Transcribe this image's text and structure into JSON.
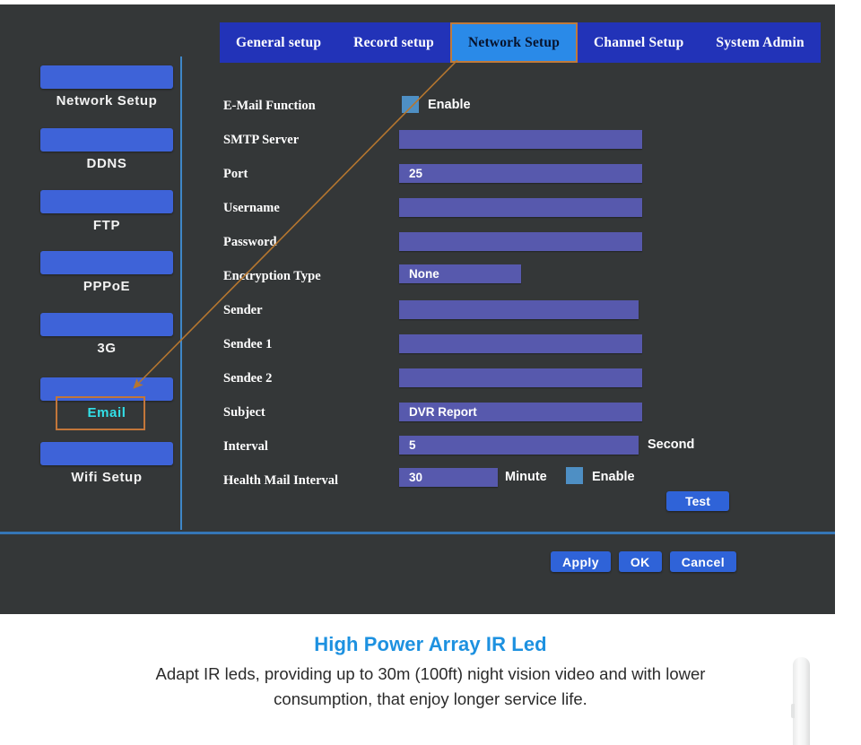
{
  "panel": {
    "tabs": [
      {
        "label": "General setup",
        "active": false
      },
      {
        "label": "Record setup",
        "active": false
      },
      {
        "label": "Network Setup",
        "active": true
      },
      {
        "label": "Channel Setup",
        "active": false
      },
      {
        "label": "System Admin",
        "active": false
      }
    ],
    "sidebar": {
      "items": [
        {
          "label": "Network  Setup",
          "highlight": false
        },
        {
          "label": "DDNS",
          "highlight": false
        },
        {
          "label": "FTP",
          "highlight": false
        },
        {
          "label": "PPPoE",
          "highlight": false
        },
        {
          "label": "3G",
          "highlight": false
        },
        {
          "label": "Email",
          "highlight": true
        },
        {
          "label": "Wifi Setup",
          "highlight": false
        }
      ]
    },
    "form": {
      "rows": [
        {
          "label": "E-Mail Function",
          "type": "checkbox",
          "checkbox_label": "Enable",
          "checked": true
        },
        {
          "label": "SMTP Server",
          "type": "text",
          "value": ""
        },
        {
          "label": "Port",
          "type": "text",
          "value": "25"
        },
        {
          "label": "Username",
          "type": "text",
          "value": ""
        },
        {
          "label": "Password",
          "type": "text",
          "value": ""
        },
        {
          "label": "Enctryption Type",
          "type": "select",
          "value": "None"
        },
        {
          "label": "Sender",
          "type": "text",
          "value": ""
        },
        {
          "label": "Sendee 1",
          "type": "text",
          "value": ""
        },
        {
          "label": "Sendee 2",
          "type": "text",
          "value": ""
        },
        {
          "label": "Subject",
          "type": "text",
          "value": "DVR Report"
        },
        {
          "label": "Interval",
          "type": "text",
          "value": "5",
          "unit": "Second"
        },
        {
          "label": "Health Mail Interval",
          "type": "text",
          "value": "30",
          "unit": "Minute",
          "checkbox_label": "Enable",
          "checked": true
        }
      ],
      "test_button": "Test"
    },
    "footer": {
      "apply": "Apply",
      "ok": "OK",
      "cancel": "Cancel"
    },
    "annotation": {
      "arrow_color": "#b5762f",
      "box_color": "#c2763a",
      "highlight_text_color": "#32e0e8"
    },
    "colors": {
      "panel_bg": "#343738",
      "tab_bg": "#2233b8",
      "tab_active_bg": "#2a8ae8",
      "input_bg": "#5759ad",
      "chip_bg": "#3e63d8",
      "checkbox_bg": "#4e8fc4",
      "button_bg": "#2f63d8",
      "divider": "#3f87c8"
    }
  },
  "caption": {
    "title": "High Power Array IR Led",
    "body": "Adapt  IR leds, providing up to 30m (100ft) night vision video and with lower consumption, that enjoy longer service life.",
    "title_color": "#1d91e0"
  }
}
